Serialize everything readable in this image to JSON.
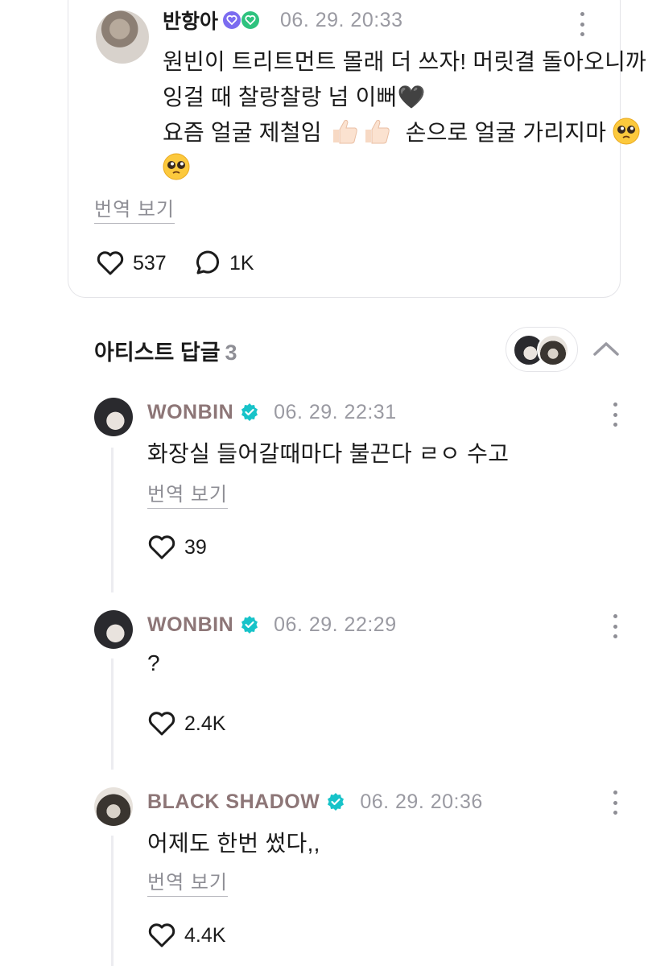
{
  "post": {
    "author": "반항아",
    "badge_icons": [
      "dotted-heart-badge-icon",
      "green-heart-badge-icon"
    ],
    "time": "06. 29. 20:33",
    "lines": [
      "원빈이 트리트먼트 몰래 더 쓰자! 머릿결 돌아오니까",
      "잉걸 때 찰랑찰랑 넘 이뻐🖤",
      "요즘 얼굴 제철임",
      "손으로 얼굴 가리지마"
    ],
    "translate_label": "번역 보기",
    "likes": "537",
    "comments": "1K"
  },
  "replies_section": {
    "title": "아티스트 답글",
    "count": "3"
  },
  "replies": [
    {
      "author": "WONBIN",
      "time": "06. 29. 22:31",
      "text": "화장실 들어갈때마다 불끈다 ㄹㅇ 수고",
      "translate_label": "번역 보기",
      "likes": "39"
    },
    {
      "author": "WONBIN",
      "time": "06. 29. 22:29",
      "text": "?",
      "likes": "2.4K"
    },
    {
      "author": "BLACK SHADOW",
      "time": "06. 29. 20:36",
      "text": "어제도 한번 썼다,,",
      "translate_label": "번역 보기",
      "likes": "4.4K"
    }
  ],
  "colors": {
    "artist_name": "#8d7677",
    "verified": "#17c3c9",
    "muted": "#9a9aa2"
  }
}
